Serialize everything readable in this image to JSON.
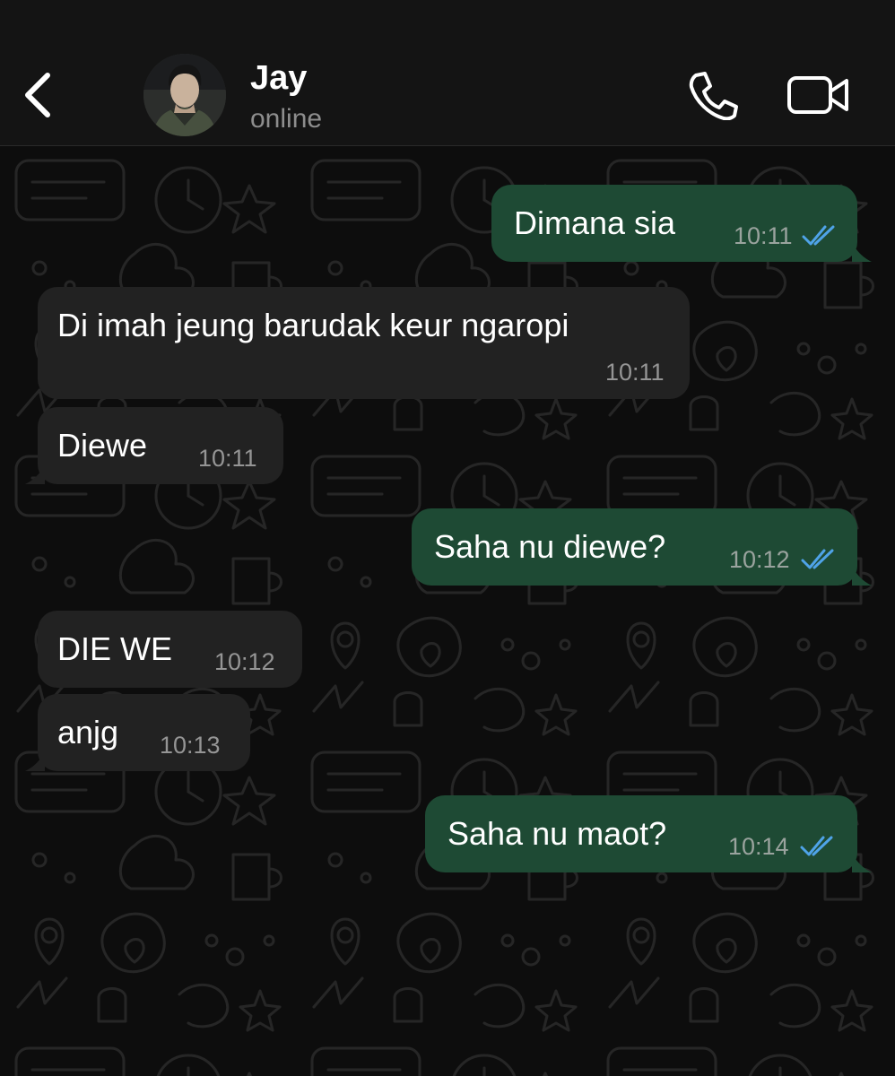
{
  "header": {
    "contact_name": "Jay",
    "status": "online",
    "icons": {
      "back": "chevron-left-icon",
      "call": "phone-icon",
      "video": "video-camera-icon"
    }
  },
  "colors": {
    "header_bg": "#141414",
    "chat_bg": "#0d0d0d",
    "outgoing_bubble": "#1e4a34",
    "incoming_bubble": "#222222",
    "read_ticks": "#4fa3e8",
    "timestamp": "#959595"
  },
  "messages": [
    {
      "direction": "outgoing",
      "text": "Dimana sia",
      "time": "10:11",
      "read": true
    },
    {
      "direction": "incoming",
      "text": "Di imah jeung barudak keur ngaropi",
      "time": "10:11"
    },
    {
      "direction": "incoming",
      "text": "Diewe",
      "time": "10:11"
    },
    {
      "direction": "outgoing",
      "text": "Saha nu diewe?",
      "time": "10:12",
      "read": true
    },
    {
      "direction": "incoming",
      "text": "DIE WE",
      "time": "10:12"
    },
    {
      "direction": "incoming",
      "text": "anjg",
      "time": "10:13"
    },
    {
      "direction": "outgoing",
      "text": "Saha nu maot?",
      "time": "10:14",
      "read": true
    }
  ]
}
